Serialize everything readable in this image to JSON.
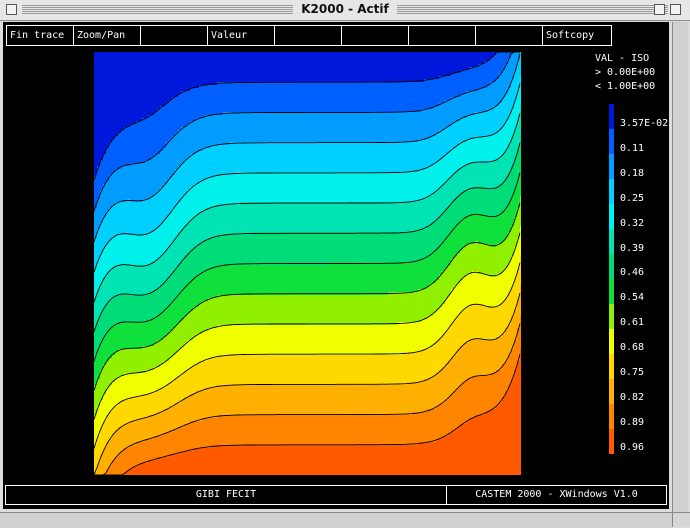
{
  "window": {
    "title": "K2000 - Actif"
  },
  "menu": {
    "items": [
      "Fin trace",
      "Zoom/Pan",
      "",
      "Valeur",
      "",
      "",
      "",
      "",
      "Softcopy"
    ]
  },
  "legend": {
    "title": "VAL - ISO",
    "lower": "> 0.00E+00",
    "upper": "< 1.00E+00",
    "levels": [
      "3.57E-02",
      "0.11",
      "0.18",
      "0.25",
      "0.32",
      "0.39",
      "0.46",
      "0.54",
      "0.61",
      "0.68",
      "0.75",
      "0.82",
      "0.89",
      "0.96"
    ],
    "colors": [
      "#0018dc",
      "#0060ff",
      "#009cff",
      "#00d0ff",
      "#00f0ec",
      "#00e4b4",
      "#00dc78",
      "#10e03c",
      "#90f000",
      "#f0ff00",
      "#ffd800",
      "#ffb000",
      "#ff8400",
      "#ff5a00"
    ]
  },
  "status": {
    "left": "GIBI FECIT",
    "right": "CASTEM 2000 - XWindows V1.0"
  }
}
